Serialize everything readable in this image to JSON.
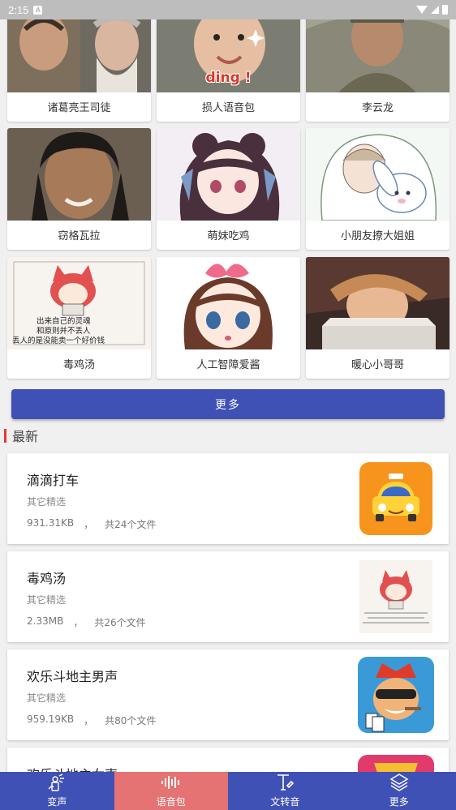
{
  "status_bar": {
    "time": "2:15",
    "notification_letter": "A"
  },
  "grid": {
    "row1": [
      {
        "label": "诸葛亮王司徒"
      },
      {
        "label": "损人语音包",
        "overlay_text": "ding !"
      },
      {
        "label": "李云龙"
      }
    ],
    "row2": [
      {
        "label": "窃格瓦拉"
      },
      {
        "label": "萌妹吃鸡"
      },
      {
        "label": "小朋友撩大姐姐"
      }
    ],
    "row3": [
      {
        "label": "毒鸡汤",
        "overlay_text": [
          "出来自己的灵魂",
          "和原则并不丢人",
          "丢人的是没能卖一个好价钱"
        ]
      },
      {
        "label": "人工智障爱酱"
      },
      {
        "label": "暖心小哥哥"
      }
    ]
  },
  "more_button": {
    "label": "更多"
  },
  "latest": {
    "title": "最新",
    "items": [
      {
        "name": "滴滴打车",
        "category": "其它精选",
        "size": "931.31KB",
        "sep": "，",
        "files": "共24个文件"
      },
      {
        "name": "毒鸡汤",
        "category": "其它精选",
        "size": "2.33MB",
        "sep": "，",
        "files": "共26个文件"
      },
      {
        "name": "欢乐斗地主男声",
        "category": "其它精选",
        "size": "959.19KB",
        "sep": "，",
        "files": "共80个文件"
      },
      {
        "name": "欢乐斗地主女声"
      }
    ]
  },
  "tabbar": {
    "tabs": [
      {
        "label": "变声",
        "icon": "voice-change-icon",
        "active": false
      },
      {
        "label": "语音包",
        "icon": "waveform-icon",
        "active": true
      },
      {
        "label": "文转音",
        "icon": "text-to-speech-icon",
        "active": false
      },
      {
        "label": "更多",
        "icon": "layers-icon",
        "active": false
      }
    ]
  },
  "colors": {
    "primary": "#3f51b5",
    "active_tab": "#e57373",
    "section_accent": "#e53935"
  }
}
